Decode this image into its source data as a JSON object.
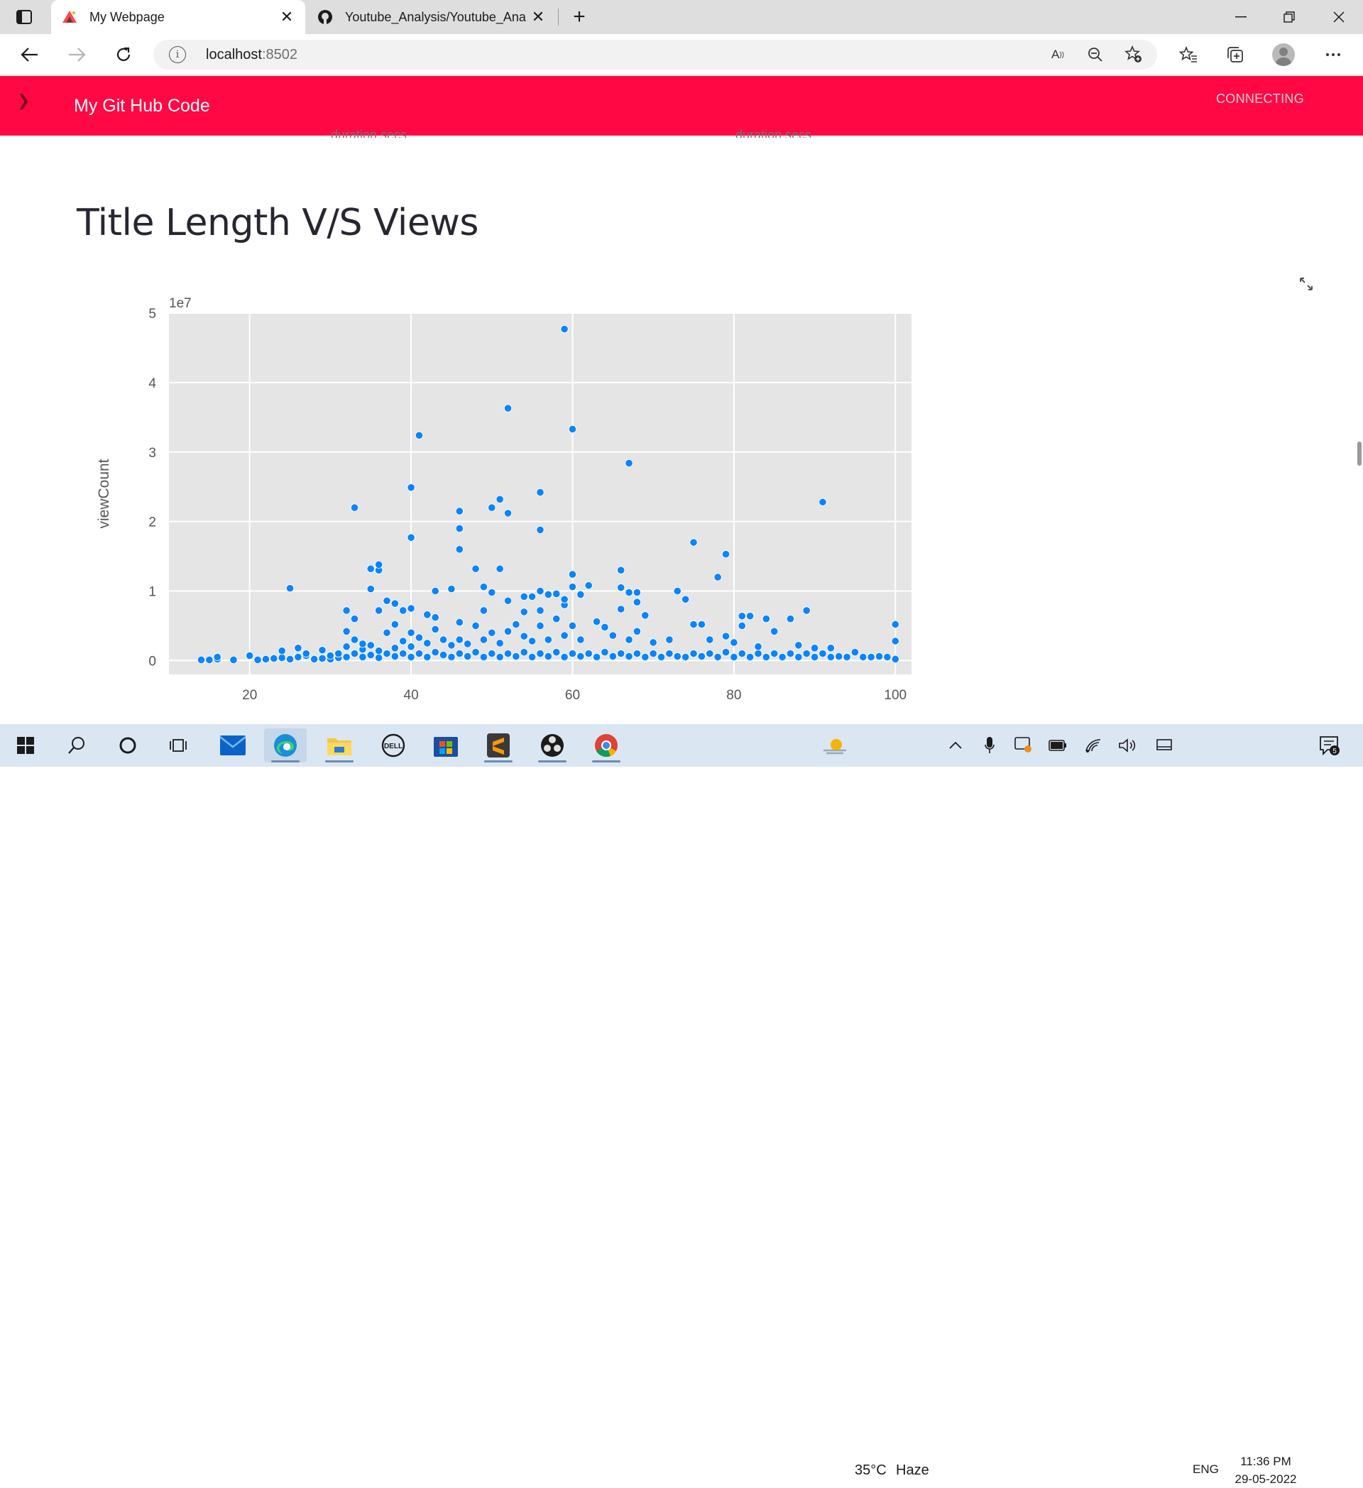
{
  "browser": {
    "tabs": [
      {
        "title": "My Webpage",
        "active": true,
        "icon": "streamlit-favicon"
      },
      {
        "title": "Youtube_Analysis/Youtube_Analy",
        "active": false,
        "icon": "github-favicon"
      }
    ],
    "address": {
      "host": "localhost",
      "port": ":8502"
    }
  },
  "app": {
    "header_title": "My Git Hub Code",
    "status": "CONNECTING",
    "header_color": "#ff0844"
  },
  "content": {
    "cut_labels": [
      "duration secs",
      "duration secs"
    ],
    "section_title": "Title Length V/S Views"
  },
  "chart_data": {
    "type": "scatter",
    "title": "",
    "xlabel": "",
    "ylabel": "viewCount",
    "y_offset_label": "1e7",
    "xlim": [
      10,
      102
    ],
    "ylim": [
      -0.2,
      5.0
    ],
    "x_ticks": [
      20,
      40,
      60,
      80,
      100
    ],
    "y_ticks": [
      0,
      1,
      2,
      3,
      4,
      5
    ],
    "grid": true,
    "point_color": "#0a84ff",
    "background": "#e5e5e5",
    "points": [
      [
        14,
        0.01
      ],
      [
        15,
        0.01
      ],
      [
        16,
        0.02
      ],
      [
        16,
        0.05
      ],
      [
        18,
        0.01
      ],
      [
        20,
        0.07
      ],
      [
        21,
        0.01
      ],
      [
        22,
        0.02
      ],
      [
        23,
        0.03
      ],
      [
        24,
        0.04
      ],
      [
        24,
        0.14
      ],
      [
        25,
        0.02
      ],
      [
        25,
        1.04
      ],
      [
        26,
        0.05
      ],
      [
        26,
        0.18
      ],
      [
        27,
        0.07
      ],
      [
        27,
        0.1
      ],
      [
        28,
        0.02
      ],
      [
        29,
        0.03
      ],
      [
        29,
        0.15
      ],
      [
        30,
        0.02
      ],
      [
        30,
        0.07
      ],
      [
        31,
        0.04
      ],
      [
        31,
        0.1
      ],
      [
        32,
        0.05
      ],
      [
        32,
        0.2
      ],
      [
        32,
        0.42
      ],
      [
        32,
        0.72
      ],
      [
        33,
        0.1
      ],
      [
        33,
        0.3
      ],
      [
        33,
        0.6
      ],
      [
        33,
        2.2
      ],
      [
        34,
        0.05
      ],
      [
        34,
        0.16
      ],
      [
        34,
        0.24
      ],
      [
        35,
        0.08
      ],
      [
        35,
        0.22
      ],
      [
        35,
        1.03
      ],
      [
        35,
        1.32
      ],
      [
        36,
        0.04
      ],
      [
        36,
        0.14
      ],
      [
        36,
        0.72
      ],
      [
        36,
        1.3
      ],
      [
        36,
        1.38
      ],
      [
        37,
        0.1
      ],
      [
        37,
        0.4
      ],
      [
        37,
        0.86
      ],
      [
        38,
        0.06
      ],
      [
        38,
        0.18
      ],
      [
        38,
        0.52
      ],
      [
        38,
        0.82
      ],
      [
        39,
        0.1
      ],
      [
        39,
        0.28
      ],
      [
        39,
        0.72
      ],
      [
        40,
        0.05
      ],
      [
        40,
        0.2
      ],
      [
        40,
        0.4
      ],
      [
        40,
        0.75
      ],
      [
        40,
        1.77
      ],
      [
        40,
        2.49
      ],
      [
        41,
        0.1
      ],
      [
        41,
        0.33
      ],
      [
        41,
        3.24
      ],
      [
        42,
        0.05
      ],
      [
        42,
        0.25
      ],
      [
        42,
        0.66
      ],
      [
        43,
        0.12
      ],
      [
        43,
        0.45
      ],
      [
        43,
        0.62
      ],
      [
        43,
        1.0
      ],
      [
        44,
        0.08
      ],
      [
        44,
        0.3
      ],
      [
        45,
        0.05
      ],
      [
        45,
        0.22
      ],
      [
        45,
        1.03
      ],
      [
        46,
        0.1
      ],
      [
        46,
        0.3
      ],
      [
        46,
        0.55
      ],
      [
        46,
        1.6
      ],
      [
        46,
        1.9
      ],
      [
        46,
        2.15
      ],
      [
        47,
        0.06
      ],
      [
        47,
        0.24
      ],
      [
        48,
        0.12
      ],
      [
        48,
        0.5
      ],
      [
        48,
        1.32
      ],
      [
        49,
        0.05
      ],
      [
        49,
        0.3
      ],
      [
        49,
        0.72
      ],
      [
        49,
        1.06
      ],
      [
        50,
        0.1
      ],
      [
        50,
        0.4
      ],
      [
        50,
        0.98
      ],
      [
        50,
        2.2
      ],
      [
        51,
        0.05
      ],
      [
        51,
        0.25
      ],
      [
        51,
        1.32
      ],
      [
        51,
        2.32
      ],
      [
        52,
        0.1
      ],
      [
        52,
        0.42
      ],
      [
        52,
        0.86
      ],
      [
        52,
        2.12
      ],
      [
        52,
        3.63
      ],
      [
        53,
        0.06
      ],
      [
        53,
        0.52
      ],
      [
        54,
        0.12
      ],
      [
        54,
        0.35
      ],
      [
        54,
        0.7
      ],
      [
        54,
        0.92
      ],
      [
        55,
        0.05
      ],
      [
        55,
        0.28
      ],
      [
        55,
        0.92
      ],
      [
        56,
        0.1
      ],
      [
        56,
        0.5
      ],
      [
        56,
        0.72
      ],
      [
        56,
        1.0
      ],
      [
        56,
        1.88
      ],
      [
        56,
        2.42
      ],
      [
        57,
        0.06
      ],
      [
        57,
        0.3
      ],
      [
        57,
        0.95
      ],
      [
        58,
        0.12
      ],
      [
        58,
        0.6
      ],
      [
        58,
        0.96
      ],
      [
        59,
        0.05
      ],
      [
        59,
        0.36
      ],
      [
        59,
        0.8
      ],
      [
        59,
        0.88
      ],
      [
        59,
        4.77
      ],
      [
        60,
        0.1
      ],
      [
        60,
        0.5
      ],
      [
        60,
        1.06
      ],
      [
        60,
        1.24
      ],
      [
        60,
        3.33
      ],
      [
        61,
        0.06
      ],
      [
        61,
        0.3
      ],
      [
        61,
        0.95
      ],
      [
        62,
        0.1
      ],
      [
        62,
        1.08
      ],
      [
        63,
        0.05
      ],
      [
        63,
        0.56
      ],
      [
        64,
        0.12
      ],
      [
        64,
        0.48
      ],
      [
        65,
        0.06
      ],
      [
        65,
        0.36
      ],
      [
        66,
        0.1
      ],
      [
        66,
        0.74
      ],
      [
        66,
        1.05
      ],
      [
        66,
        1.3
      ],
      [
        67,
        0.06
      ],
      [
        67,
        0.3
      ],
      [
        67,
        0.98
      ],
      [
        67,
        2.84
      ],
      [
        68,
        0.1
      ],
      [
        68,
        0.42
      ],
      [
        68,
        0.84
      ],
      [
        68,
        0.98
      ],
      [
        69,
        0.05
      ],
      [
        69,
        0.65
      ],
      [
        70,
        0.1
      ],
      [
        70,
        0.26
      ],
      [
        71,
        0.05
      ],
      [
        72,
        0.1
      ],
      [
        72,
        0.3
      ],
      [
        73,
        0.06
      ],
      [
        73,
        1.0
      ],
      [
        74,
        0.05
      ],
      [
        74,
        0.88
      ],
      [
        75,
        0.1
      ],
      [
        75,
        0.52
      ],
      [
        75,
        1.7
      ],
      [
        76,
        0.06
      ],
      [
        76,
        0.52
      ],
      [
        77,
        0.1
      ],
      [
        77,
        0.3
      ],
      [
        78,
        0.05
      ],
      [
        78,
        1.2
      ],
      [
        79,
        0.12
      ],
      [
        79,
        0.35
      ],
      [
        79,
        1.53
      ],
      [
        80,
        0.05
      ],
      [
        80,
        0.26
      ],
      [
        81,
        0.1
      ],
      [
        81,
        0.5
      ],
      [
        81,
        0.64
      ],
      [
        82,
        0.05
      ],
      [
        82,
        0.64
      ],
      [
        83,
        0.1
      ],
      [
        83,
        0.2
      ],
      [
        84,
        0.05
      ],
      [
        84,
        0.6
      ],
      [
        85,
        0.1
      ],
      [
        85,
        0.42
      ],
      [
        86,
        0.05
      ],
      [
        87,
        0.1
      ],
      [
        87,
        0.6
      ],
      [
        88,
        0.05
      ],
      [
        88,
        0.22
      ],
      [
        89,
        0.1
      ],
      [
        89,
        0.72
      ],
      [
        90,
        0.05
      ],
      [
        90,
        0.18
      ],
      [
        91,
        0.1
      ],
      [
        91,
        2.28
      ],
      [
        92,
        0.05
      ],
      [
        92,
        0.18
      ],
      [
        93,
        0.06
      ],
      [
        94,
        0.05
      ],
      [
        95,
        0.12
      ],
      [
        96,
        0.05
      ],
      [
        97,
        0.05
      ],
      [
        98,
        0.06
      ],
      [
        99,
        0.05
      ],
      [
        100,
        0.02
      ],
      [
        100,
        0.28
      ],
      [
        100,
        0.52
      ]
    ]
  },
  "taskbar": {
    "weather": {
      "temp": "35°C",
      "condition": "Haze"
    },
    "language": "ENG",
    "time": "11:36 PM",
    "date": "29-05-2022",
    "notifications": "5"
  }
}
